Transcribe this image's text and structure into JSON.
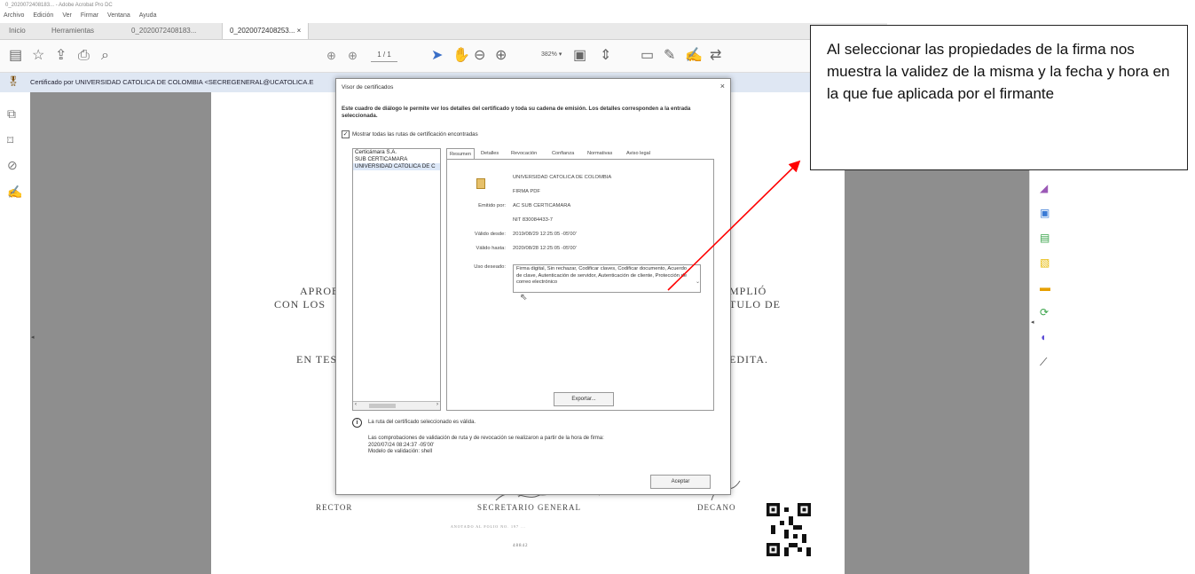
{
  "window": {
    "title": "0_2020072408183... - Adobe Acrobat Pro DC"
  },
  "menu": [
    "Archivo",
    "Edición",
    "Ver",
    "Firmar",
    "Ventana",
    "Ayuda"
  ],
  "tabs": [
    "Inicio",
    "Herramientas",
    "0_2020072408183...",
    "0_2020072408253..."
  ],
  "toolbar": {
    "page_current": "1",
    "page_total": "/ 1",
    "zoom": "382% ▾"
  },
  "signature_bar": {
    "text": "Certificado por UNIVERSIDAD CATOLICA DE COLOMBIA <SECREGENERAL@UCATOLICA.E"
  },
  "document": {
    "left_line1": "APROBÓ",
    "left_line2": "CON LOS",
    "left_line3": "EN TEST",
    "right_line1": "MPLIÓ",
    "right_line2": "TULO DE",
    "right_line3": "EDITA.",
    "rector": "RECTOR",
    "secretario": "SECRETARIO GENERAL",
    "decano": "DECANO",
    "small_line": "ANOTADO AL FOLIO NO. 197 ...",
    "number": "48842"
  },
  "dialog": {
    "title": "Visor de certificados",
    "close": "×",
    "intro": "Este cuadro de diálogo le permite ver los detalles del certificado y toda su cadena de emisión. Los detalles corresponden a la entrada seleccionada.",
    "show_all": "Mostrar todas las rutas de certificación encontradas",
    "chain": [
      "Certicámara S.A.",
      "SUB CERTICAMARA",
      "UNIVERSIDAD CATOLICA DE C"
    ],
    "tabs": [
      "Resumen",
      "Detalles",
      "Revocación",
      "Confianza",
      "Normativas",
      "Aviso legal"
    ],
    "summary": {
      "subject": "UNIVERSIDAD CATOLICA DE COLOMBIA",
      "subject2": "FIRMA PDF",
      "issued_by_label": "Emitido por:",
      "issued_by": "AC SUB CERTICAMARA",
      "issued_by_nit": "NIT 830084433-7",
      "valid_from_label": "Válido desde:",
      "valid_from": "2019/08/29 12:25:05 -05'00'",
      "valid_to_label": "Válido hasta:",
      "valid_to": "2020/08/28 12:25:05 -05'00'",
      "intended_use_label": "Uso deseado:",
      "intended_use": "Firma digital, Sin rechazar, Codificar claves, Codificar documento, Acuerdo de clave, Autenticación de servidor, Autenticación de cliente, Protección de correo electrónico"
    },
    "export": "Exportar...",
    "status": "La ruta del certificado seleccionado es válida.",
    "validation_note": "Las comprobaciones de validación de ruta y de revocación se realizaron a partir de la hora de firma:",
    "validation_time": "2020/07/24 08:24:37 -05'00'",
    "validation_model": "Modelo de validación: shell",
    "accept": "Aceptar"
  },
  "callout": {
    "text": "Al seleccionar las propiedades de la firma nos muestra la validez de la misma y la fecha y hora en la que fue aplicada por el firmante"
  },
  "colors": {
    "arrow": "#ff0000",
    "sigbar": "#dfe7f3",
    "doc_bg": "#8e8e8e"
  }
}
